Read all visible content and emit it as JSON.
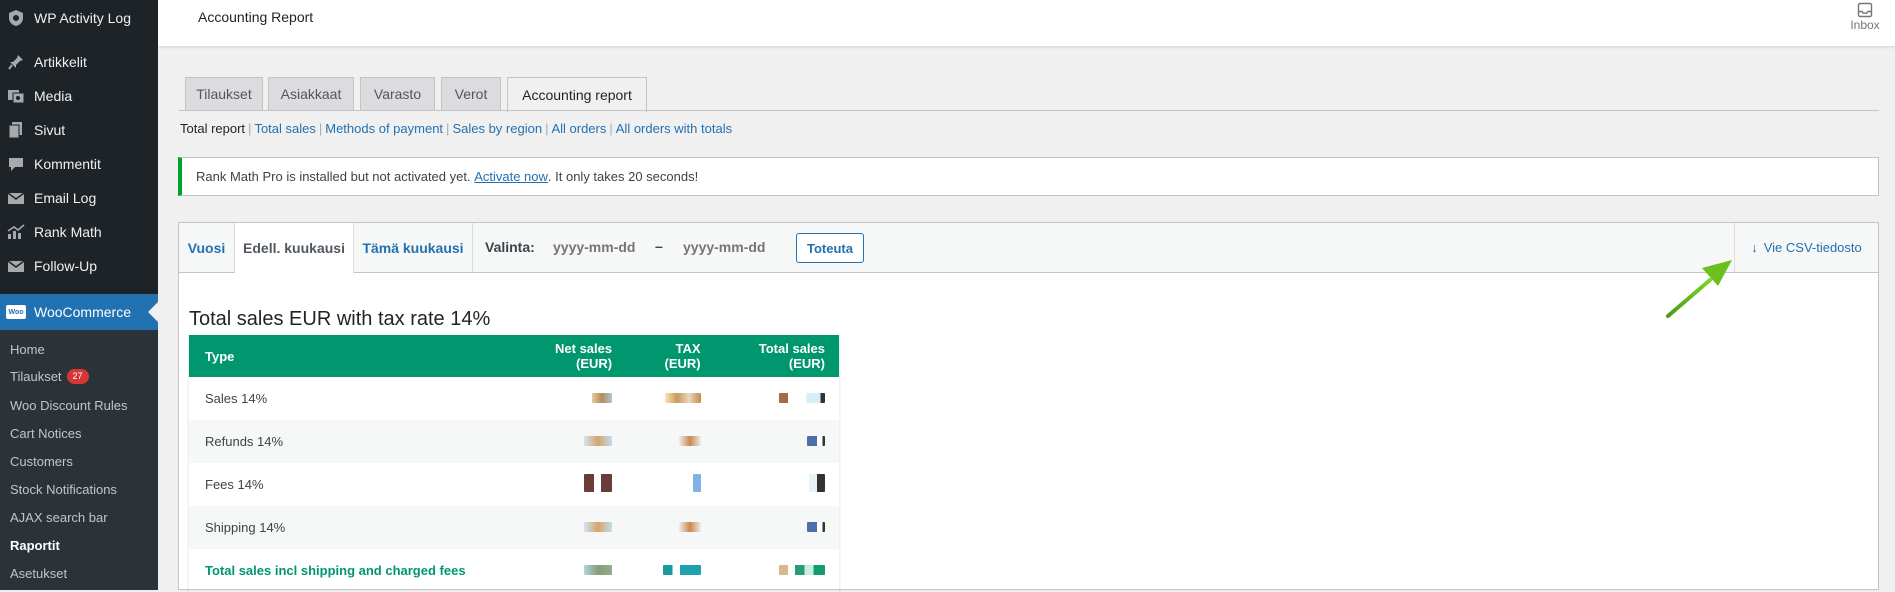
{
  "sidebar": {
    "top": [
      {
        "label": "WP Activity Log",
        "icon": "shield-icon"
      },
      {
        "label": "Artikkelit",
        "icon": "pin-icon"
      },
      {
        "label": "Media",
        "icon": "media-icon"
      },
      {
        "label": "Sivut",
        "icon": "pages-icon"
      },
      {
        "label": "Kommentit",
        "icon": "comment-icon"
      },
      {
        "label": "Email Log",
        "icon": "email-icon"
      },
      {
        "label": "Rank Math",
        "icon": "chart-icon"
      },
      {
        "label": "Follow-Up",
        "icon": "email-icon"
      }
    ],
    "woocommerce": {
      "label": "WooCommerce",
      "badge": "Woo"
    },
    "submenu": [
      {
        "label": "Home"
      },
      {
        "label": "Tilaukset",
        "count": "27"
      },
      {
        "label": "Woo Discount Rules"
      },
      {
        "label": "Cart Notices"
      },
      {
        "label": "Customers"
      },
      {
        "label": "Stock Notifications"
      },
      {
        "label": "AJAX search bar"
      },
      {
        "label": "Raportit",
        "current": true
      },
      {
        "label": "Asetukset"
      }
    ]
  },
  "header": {
    "title": "Accounting Report",
    "inbox_label": "Inbox"
  },
  "tabs": [
    "Tilaukset",
    "Asiakkaat",
    "Varasto",
    "Verot",
    "Accounting report"
  ],
  "sublinks": {
    "current": "Total report",
    "links": [
      "Total sales",
      "Methods of payment",
      "Sales by region",
      "All orders",
      "All orders with totals"
    ]
  },
  "notice": {
    "before": "Rank Math Pro is installed but not activated yet. ",
    "link": "Activate now",
    "after": ". It only takes 20 seconds!"
  },
  "range": {
    "tabs": [
      "Vuosi",
      "Edell. kuukausi",
      "Tämä kuukausi"
    ],
    "valinta_label": "Valinta:",
    "start_placeholder": "yyyy-mm-dd",
    "separator": "–",
    "end_placeholder": "yyyy-mm-dd",
    "apply_label": "Toteuta",
    "export_label": "Vie CSV-tiedosto"
  },
  "report": {
    "heading": "Total sales EUR with tax rate 14%",
    "columns": [
      "Type",
      "Net sales (EUR)",
      "TAX (EUR)",
      "Total sales (EUR)"
    ],
    "rows": [
      {
        "label": "Sales 14%"
      },
      {
        "label": "Refunds 14%"
      },
      {
        "label": "Fees 14%"
      },
      {
        "label": "Shipping 14%"
      },
      {
        "label": "Total sales incl shipping and charged fees"
      }
    ]
  },
  "colors": {
    "sidebar_bg": "#1d2327",
    "wp_blue": "#2271b1",
    "table_header": "#00976f",
    "notice_green": "#00a32a",
    "annotation_arrow": "#6bc01e"
  }
}
